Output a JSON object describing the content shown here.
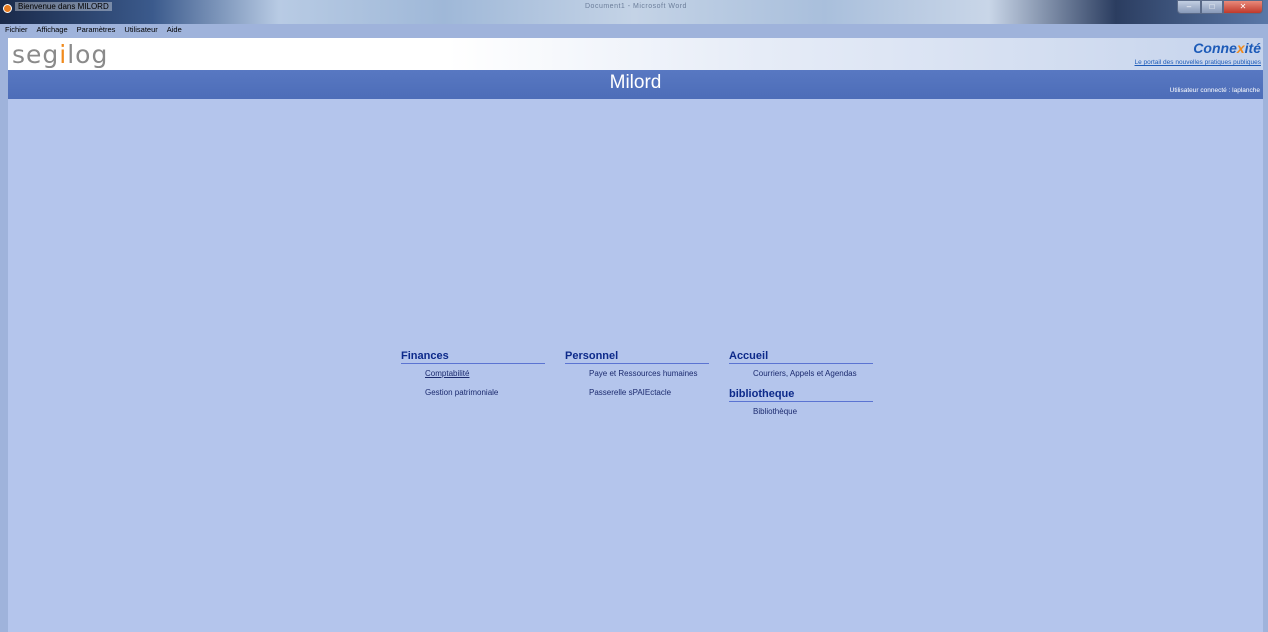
{
  "window": {
    "title": "Bienvenue dans MILORD",
    "background_title": "Document1 - Microsoft Word",
    "controls": {
      "minimize": "–",
      "maximize": "□",
      "close": "✕"
    }
  },
  "menu": [
    "Fichier",
    "Affichage",
    "Paramètres",
    "Utilisateur",
    "Aide"
  ],
  "header": {
    "logo_prefix": "seg",
    "logo_dot": "i",
    "logo_suffix": "log",
    "brand_prefix": "Conne",
    "brand_x": "x",
    "brand_suffix": "ité",
    "portal_link": "Le portail des nouvelles pratiques publiques"
  },
  "banner": {
    "title": "Milord",
    "user_label": "Utilisateur connecté :",
    "user_name": "laplanche"
  },
  "sections": {
    "finances": {
      "title": "Finances",
      "links": [
        "Comptabilité",
        "Gestion patrimoniale"
      ]
    },
    "personnel": {
      "title": "Personnel",
      "links": [
        "Paye et Ressources humaines",
        "Passerelle sPAIEctacle"
      ]
    },
    "accueil": {
      "title": "Accueil",
      "links": [
        "Courriers, Appels et Agendas"
      ]
    },
    "bibliotheque": {
      "title": "bibliotheque",
      "links": [
        "Bibliothèque"
      ]
    }
  },
  "colors": {
    "banner": "#4d6db8",
    "content_bg": "#b4c5ec",
    "section_title": "#0d2a8a",
    "accent_orange": "#f08a1c",
    "brand_blue": "#1d5bb8"
  }
}
